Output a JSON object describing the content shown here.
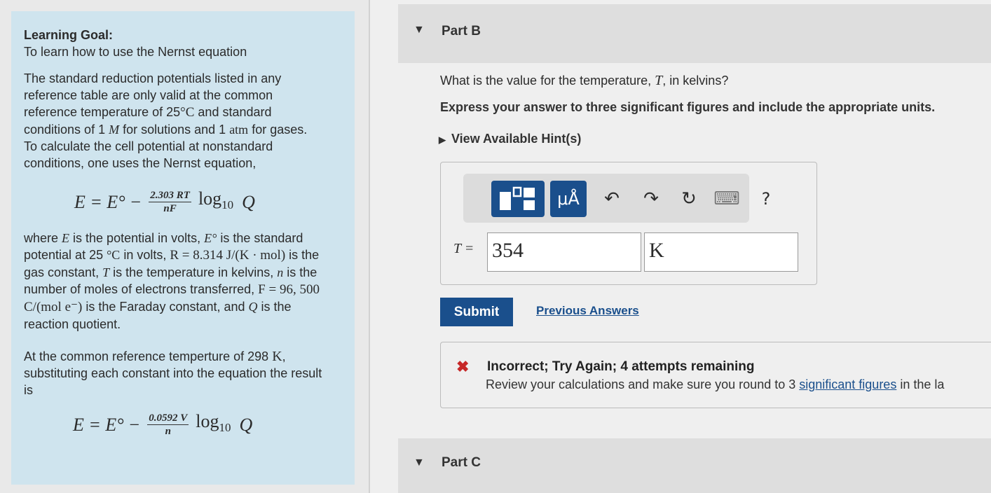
{
  "goal": {
    "title": "Learning Goal:",
    "subtitle": "To learn how to use the Nernst equation",
    "p1_a": "The standard reduction potentials listed in any reference table are only valid at the common reference temperature of 25",
    "p1_deg": "°C",
    "p1_b": " and standard conditions of 1 ",
    "p1_M": "M",
    "p1_c": " for solutions and 1 ",
    "p1_atm": "atm",
    "p1_d": " for gases. To calculate the cell potential at nonstandard conditions, one uses the Nernst equation,",
    "eq1_lhs": "E = E°",
    "eq1_minus": "−",
    "eq1_num": "2.303 RT",
    "eq1_den": "nF",
    "eq_log": "log",
    "eq_logsub": "10",
    "eq_Q": "Q",
    "p2_where": "where ",
    "p2_E": "E",
    "p2_a": " is the potential in volts, ",
    "p2_E0": "E°",
    "p2_b": " is the standard potential at 25 ",
    "p2_degC": "°C",
    "p2_c": " in volts, ",
    "p2_R": "R = 8.314 J/(K · mol)",
    "p2_d": " is the gas constant, ",
    "p2_T": "T",
    "p2_e": " is the temperature in kelvins, ",
    "p2_n": "n",
    "p2_f": " is the number of moles of electrons transferred, ",
    "p2_F": "F = 96, 500 C/(mol e⁻)",
    "p2_g": " is the Faraday constant, and ",
    "p2_Q": "Q",
    "p2_h": " is the reaction quotient.",
    "p3_a": "At the common reference temperture of 298 ",
    "p3_K": "K",
    "p3_b": ", substituting each constant into the equation the result is",
    "eq2_num": "0.0592 V",
    "eq2_den": "n"
  },
  "partB": {
    "label": "Part B",
    "question_a": "What is the value for the temperature, ",
    "question_T": "T",
    "question_b": ", in kelvins?",
    "instruction": "Express your answer to three significant figures and include the appropriate units.",
    "hint": "View Available Hint(s)",
    "toolbar": {
      "units_label": "μÅ",
      "undo_icon": "↶",
      "redo_icon": "↷",
      "reset_icon": "↻",
      "keyboard_icon": "⌨",
      "help_label": "?"
    },
    "var_label": "T =",
    "value": "354",
    "unit": "K",
    "submit_label": "Submit",
    "previous_label": "Previous Answers",
    "feedback_title": "Incorrect; Try Again; 4 attempts remaining",
    "feedback_text_a": "Review your calculations and make sure you round to 3 ",
    "feedback_link": "significant figures",
    "feedback_text_b": " in the la"
  },
  "partC": {
    "label": "Part C"
  },
  "colors": {
    "accent": "#1a4f8c",
    "panel": "#cfe4ee",
    "error": "#c62828"
  }
}
